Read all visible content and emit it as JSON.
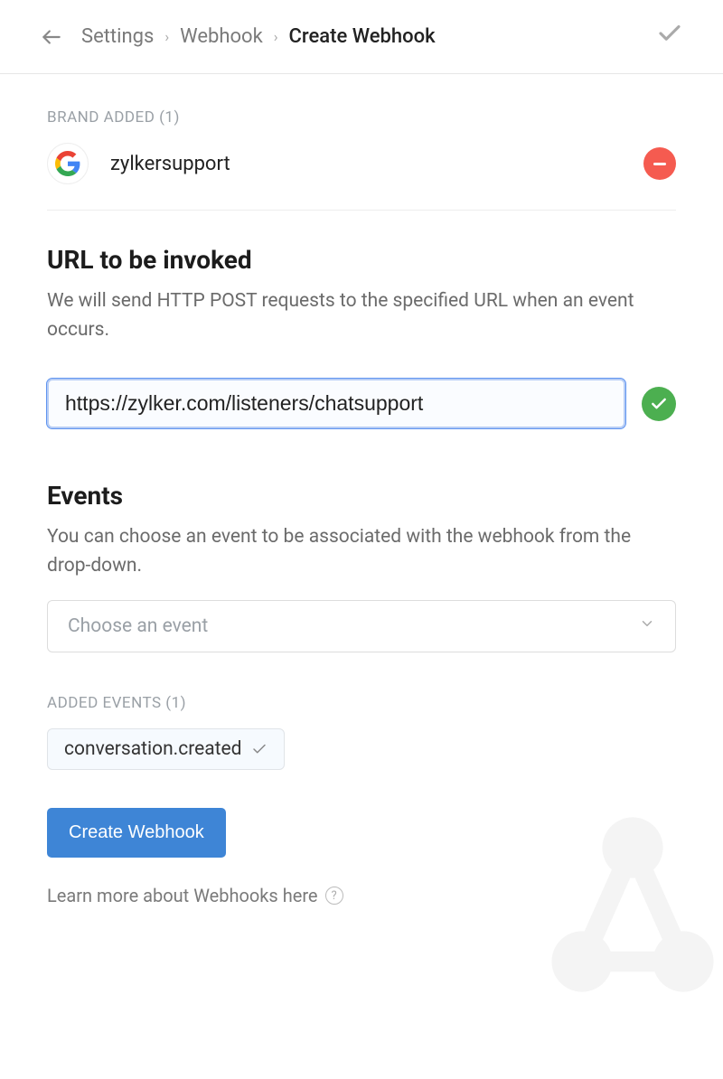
{
  "breadcrumb": {
    "item1": "Settings",
    "item2": "Webhook",
    "current": "Create Webhook"
  },
  "brand": {
    "label": "BRAND ADDED (1)",
    "name": "zylkersupport"
  },
  "url_section": {
    "title": "URL to be invoked",
    "desc": "We will send HTTP POST requests to the specified URL when an event occurs.",
    "value": "https://zylker.com/listeners/chatsupport"
  },
  "events_section": {
    "title": "Events",
    "desc": "You can choose an event to be associated with the webhook from the drop-down.",
    "placeholder": "Choose an event",
    "added_label": "ADDED EVENTS (1)",
    "added_event": "conversation.created"
  },
  "actions": {
    "create_label": "Create Webhook",
    "learn_more": "Learn more about Webhooks here"
  }
}
